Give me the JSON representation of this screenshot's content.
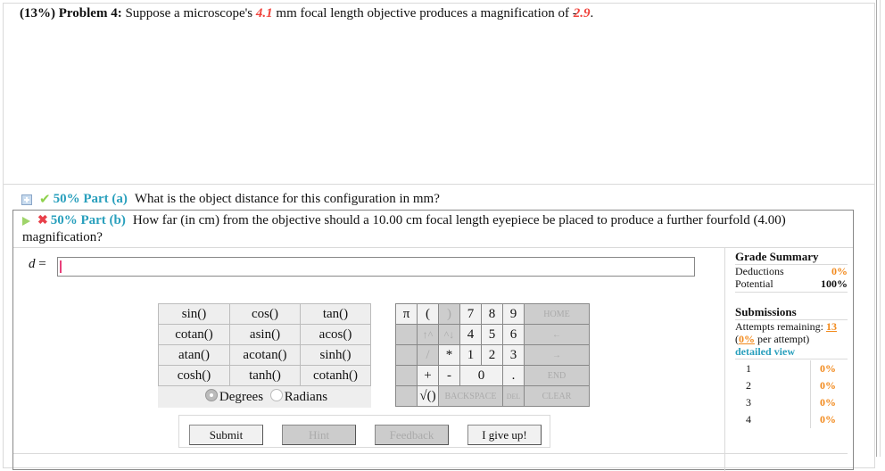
{
  "problem": {
    "weight": "(13%)",
    "label": "Problem 4:",
    "text_before": "Suppose a microscope's",
    "focal_length": "4.1",
    "text_middle": "mm focal length objective produces a magnification of",
    "magnification_sign": "-",
    "magnification": "2.9",
    "text_end": "."
  },
  "part_a": {
    "label": "50% Part (a)",
    "question": "What is the object distance for this configuration in mm?",
    "status": "correct"
  },
  "part_b": {
    "label": "50% Part (b)",
    "question": "How far (in cm) from the objective should a 10.00 cm focal length eyepiece be placed to produce a further fourfold (4.00)",
    "question_cont": "magnification?",
    "status": "incorrect"
  },
  "answer": {
    "variable": "d",
    "equals": " =",
    "value": ""
  },
  "functions": [
    [
      "sin()",
      "cos()",
      "tan()"
    ],
    [
      "cotan()",
      "asin()",
      "acos()"
    ],
    [
      "atan()",
      "acotan()",
      "sinh()"
    ],
    [
      "cosh()",
      "tanh()",
      "cotanh()"
    ]
  ],
  "angle_mode": {
    "degrees": "Degrees",
    "radians": "Radians",
    "selected": "Degrees"
  },
  "keypad": {
    "pi": "π",
    "lparen": "(",
    "rparen": ")",
    "up": "↑^",
    "down": "^↓",
    "div": "/",
    "mul": "*",
    "plus": "+",
    "minus": "-",
    "sqrt": "√()",
    "dot": ".",
    "digits": [
      "7",
      "8",
      "9",
      "4",
      "5",
      "6",
      "1",
      "2",
      "3",
      "0"
    ],
    "home": "HOME",
    "left": "←",
    "right": "→",
    "end": "END",
    "backspace": "BACKSPACE",
    "del": "DEL",
    "clear": "CLEAR"
  },
  "buttons": {
    "submit": "Submit",
    "hint": "Hint",
    "feedback": "Feedback",
    "give_up": "I give up!"
  },
  "grade_summary": {
    "title": "Grade Summary",
    "deductions_label": "Deductions",
    "deductions_value": "0%",
    "potential_label": "Potential",
    "potential_value": "100%"
  },
  "submissions": {
    "title": "Submissions",
    "attempts_label": "Attempts remaining:",
    "attempts_value": "13",
    "per_attempt_open": "(",
    "per_attempt_value": "0%",
    "per_attempt_text": " per attempt)",
    "detailed_view": "detailed view",
    "attempts": [
      {
        "n": "1",
        "pct": "0%"
      },
      {
        "n": "2",
        "pct": "0%"
      },
      {
        "n": "3",
        "pct": "0%"
      },
      {
        "n": "4",
        "pct": "0%"
      }
    ]
  }
}
